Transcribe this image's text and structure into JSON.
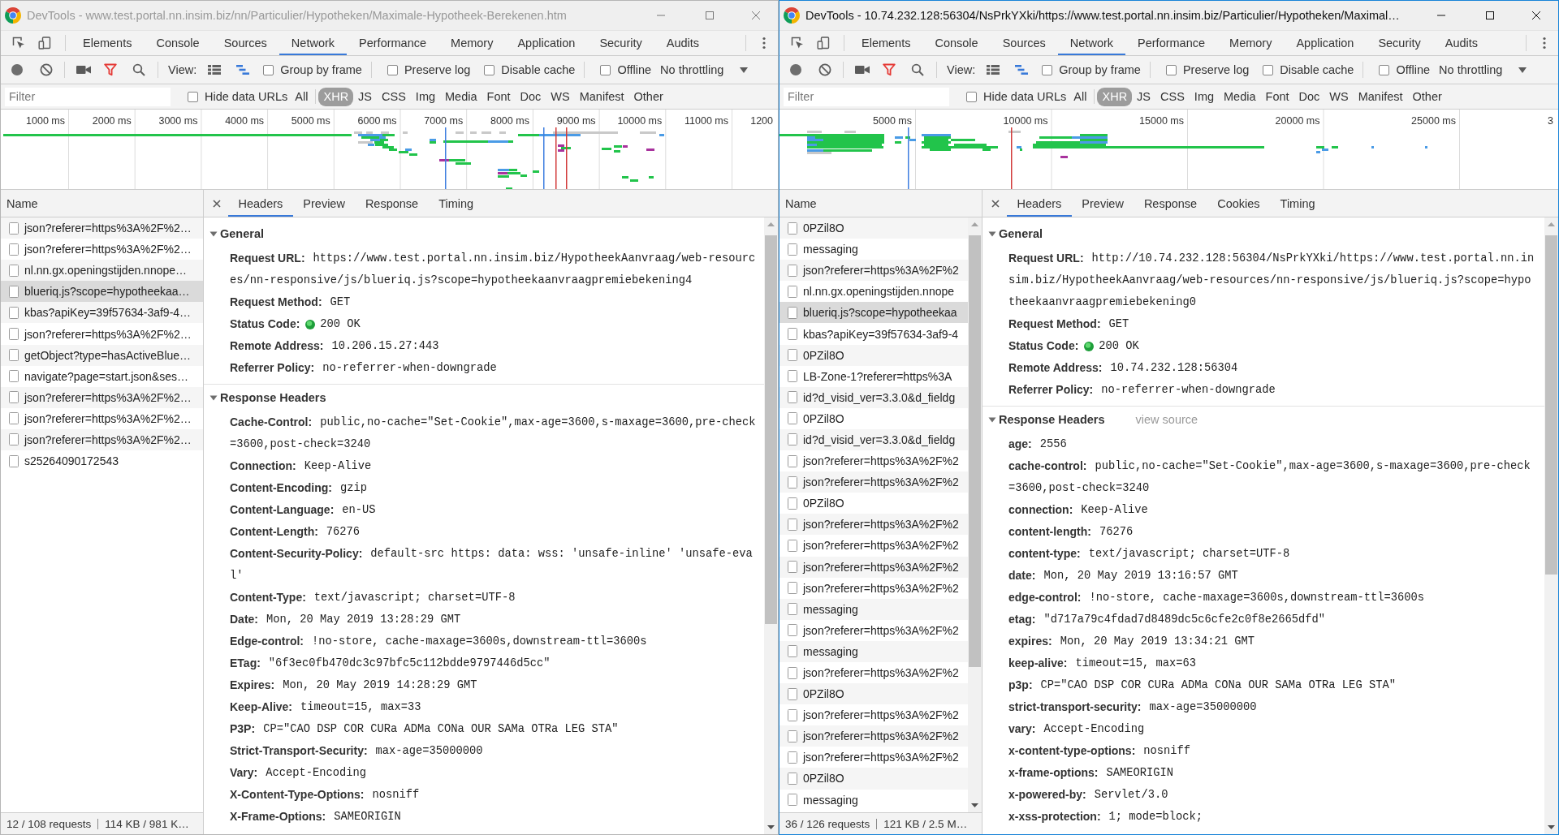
{
  "windows": [
    {
      "title": "DevTools - www.test.portal.nn.insim.biz/nn/Particulier/Hypotheken/Maximale-Hypotheek-Berekenen.htm",
      "active": false,
      "tabs": [
        {
          "label": "Elements",
          "selected": false
        },
        {
          "label": "Console",
          "selected": false
        },
        {
          "label": "Sources",
          "selected": false
        },
        {
          "label": "Network",
          "selected": true
        },
        {
          "label": "Performance",
          "selected": false
        },
        {
          "label": "Memory",
          "selected": false
        },
        {
          "label": "Application",
          "selected": false
        },
        {
          "label": "Security",
          "selected": false
        },
        {
          "label": "Audits",
          "selected": false
        }
      ],
      "toolbar": {
        "recording": false,
        "filter_on": true,
        "large_rows": false,
        "overview": true,
        "view_label": "View:",
        "option_groups": [
          [
            {
              "label": "Group by frame",
              "checked": false
            }
          ],
          [
            {
              "label": "Preserve log",
              "checked": false
            },
            {
              "label": "Disable cache",
              "checked": false
            }
          ],
          [
            {
              "label": "Offline",
              "checked": false
            }
          ]
        ],
        "throttling": "No throttling"
      },
      "filter_bar": {
        "placeholder": "Filter",
        "hide_data_urls": {
          "label": "Hide data URLs",
          "checked": false
        },
        "all": {
          "label": "All",
          "selected": false
        },
        "types": [
          {
            "label": "XHR",
            "selected": true
          },
          {
            "label": "JS",
            "selected": false
          },
          {
            "label": "CSS",
            "selected": false
          },
          {
            "label": "Img",
            "selected": false
          },
          {
            "label": "Media",
            "selected": false
          },
          {
            "label": "Font",
            "selected": false
          },
          {
            "label": "Doc",
            "selected": false
          },
          {
            "label": "WS",
            "selected": false
          },
          {
            "label": "Manifest",
            "selected": false
          },
          {
            "label": "Other",
            "selected": false
          }
        ]
      },
      "overview": {
        "ticks": [
          "1000 ms",
          "2000 ms",
          "3000 ms",
          "4000 ms",
          "5000 ms",
          "6000 ms",
          "7000 ms",
          "8000 ms",
          "9000 ms",
          "10000 ms",
          "11000 ms",
          "1200"
        ]
      },
      "requests": {
        "heading": "Name",
        "rows": [
          {
            "name": "json?referer=https%3A%2F%2…",
            "selected": false
          },
          {
            "name": "json?referer=https%3A%2F%2…",
            "selected": false
          },
          {
            "name": "nl.nn.gx.openingstijden.nnope…",
            "selected": false
          },
          {
            "name": "blueriq.js?scope=hypotheekaa…",
            "selected": true
          },
          {
            "name": "kbas?apiKey=39f57634-3af9-4…",
            "selected": false
          },
          {
            "name": "json?referer=https%3A%2F%2…",
            "selected": false
          },
          {
            "name": "getObject?type=hasActiveBlue…",
            "selected": false
          },
          {
            "name": "navigate?page=start.json&ses…",
            "selected": false
          },
          {
            "name": "json?referer=https%3A%2F%2…",
            "selected": false
          },
          {
            "name": "json?referer=https%3A%2F%2…",
            "selected": false
          },
          {
            "name": "json?referer=https%3A%2F%2…",
            "selected": false
          },
          {
            "name": "s25264090172543",
            "selected": false
          }
        ]
      },
      "details": {
        "tabs": [
          {
            "label": "Headers",
            "selected": true
          },
          {
            "label": "Preview",
            "selected": false
          },
          {
            "label": "Response",
            "selected": false
          },
          {
            "label": "Timing",
            "selected": false
          }
        ],
        "sections": [
          {
            "title": "General",
            "expanded": true,
            "headers": [
              {
                "name": "Request URL:",
                "value": "https://www.test.portal.nn.insim.biz/HypotheekAanvraag/web-resources/nn-responsive/js/blueriq.js?scope=hypotheekaanvraagpremiebekening4",
                "kind": "plain"
              },
              {
                "name": "Request Method:",
                "value": "GET",
                "kind": "plain"
              },
              {
                "name": "Status Code:",
                "value": "200 OK",
                "kind": "status"
              },
              {
                "name": "Remote Address:",
                "value": "10.206.15.27:443",
                "kind": "plain"
              },
              {
                "name": "Referrer Policy:",
                "value": "no-referrer-when-downgrade",
                "kind": "plain"
              }
            ]
          },
          {
            "title": "Response Headers",
            "expanded": true,
            "headers": [
              {
                "name": "Cache-Control:",
                "value": "public,no-cache=\"Set-Cookie\",max-age=3600,s-maxage=3600,pre-check=3600,post-check=3240",
                "kind": "plain"
              },
              {
                "name": "Connection:",
                "value": "Keep-Alive",
                "kind": "plain"
              },
              {
                "name": "Content-Encoding:",
                "value": "gzip",
                "kind": "plain"
              },
              {
                "name": "Content-Language:",
                "value": "en-US",
                "kind": "plain"
              },
              {
                "name": "Content-Length:",
                "value": "76276",
                "kind": "plain"
              },
              {
                "name": "Content-Security-Policy:",
                "value": "default-src https: data: wss: 'unsafe-inline' 'unsafe-eval'",
                "kind": "plain"
              },
              {
                "name": "Content-Type:",
                "value": "text/javascript; charset=UTF-8",
                "kind": "plain"
              },
              {
                "name": "Date:",
                "value": "Mon, 20 May 2019 13:28:29 GMT",
                "kind": "plain"
              },
              {
                "name": "Edge-control:",
                "value": "!no-store, cache-maxage=3600s,downstream-ttl=3600s",
                "kind": "plain"
              },
              {
                "name": "ETag:",
                "value": "\"6f3ec0fb470dc3c97bfc5c112bdde9797446d5cc\"",
                "kind": "plain"
              },
              {
                "name": "Expires:",
                "value": "Mon, 20 May 2019 14:28:29 GMT",
                "kind": "plain"
              },
              {
                "name": "Keep-Alive:",
                "value": "timeout=15, max=33",
                "kind": "plain"
              },
              {
                "name": "P3P:",
                "value": "CP=\"CAO DSP COR CURa ADMa CONa OUR SAMa OTRa LEG STA\"",
                "kind": "plain"
              },
              {
                "name": "Strict-Transport-Security:",
                "value": "max-age=35000000",
                "kind": "plain"
              },
              {
                "name": "Vary:",
                "value": "Accept-Encoding",
                "kind": "plain"
              },
              {
                "name": "X-Content-Type-Options:",
                "value": "nosniff",
                "kind": "plain"
              },
              {
                "name": "X-Frame-Options:",
                "value": "SAMEORIGIN",
                "kind": "plain"
              }
            ]
          }
        ]
      },
      "status_bar": {
        "requests": "12 / 108 requests",
        "transferred": "114 KB / 981 K…"
      }
    },
    {
      "title": "DevTools - 10.74.232.128:56304/NsPrkYXki/https://www.test.portal.nn.insim.biz/Particulier/Hypotheken/Maximal…",
      "active": true,
      "tabs": [
        {
          "label": "Elements",
          "selected": false
        },
        {
          "label": "Console",
          "selected": false
        },
        {
          "label": "Sources",
          "selected": false
        },
        {
          "label": "Network",
          "selected": true
        },
        {
          "label": "Performance",
          "selected": false
        },
        {
          "label": "Memory",
          "selected": false
        },
        {
          "label": "Application",
          "selected": false
        },
        {
          "label": "Security",
          "selected": false
        },
        {
          "label": "Audits",
          "selected": false
        }
      ],
      "toolbar": {
        "recording": false,
        "filter_on": true,
        "large_rows": false,
        "overview": true,
        "view_label": "View:",
        "option_groups": [
          [
            {
              "label": "Group by frame",
              "checked": false
            }
          ],
          [
            {
              "label": "Preserve log",
              "checked": false
            },
            {
              "label": "Disable cache",
              "checked": false
            }
          ],
          [
            {
              "label": "Offline",
              "checked": false
            }
          ]
        ],
        "throttling": "No throttling"
      },
      "filter_bar": {
        "placeholder": "Filter",
        "hide_data_urls": {
          "label": "Hide data URLs",
          "checked": false
        },
        "all": {
          "label": "All",
          "selected": false
        },
        "types": [
          {
            "label": "XHR",
            "selected": true
          },
          {
            "label": "JS",
            "selected": false
          },
          {
            "label": "CSS",
            "selected": false
          },
          {
            "label": "Img",
            "selected": false
          },
          {
            "label": "Media",
            "selected": false
          },
          {
            "label": "Font",
            "selected": false
          },
          {
            "label": "Doc",
            "selected": false
          },
          {
            "label": "WS",
            "selected": false
          },
          {
            "label": "Manifest",
            "selected": false
          },
          {
            "label": "Other",
            "selected": false
          }
        ]
      },
      "overview": {
        "ticks": [
          "5000 ms",
          "10000 ms",
          "15000 ms",
          "20000 ms",
          "25000 ms",
          "3"
        ]
      },
      "requests": {
        "heading": "Name",
        "rows": [
          {
            "name": "0PZil8O",
            "selected": false
          },
          {
            "name": "messaging",
            "selected": false
          },
          {
            "name": "json?referer=https%3A%2F%2",
            "selected": false
          },
          {
            "name": "nl.nn.gx.openingstijden.nnope",
            "selected": false
          },
          {
            "name": "blueriq.js?scope=hypotheekaa",
            "selected": true
          },
          {
            "name": "kbas?apiKey=39f57634-3af9-4",
            "selected": false
          },
          {
            "name": "0PZil8O",
            "selected": false
          },
          {
            "name": "LB-Zone-1?referer=https%3A",
            "selected": false
          },
          {
            "name": "id?d_visid_ver=3.3.0&d_fieldg",
            "selected": false
          },
          {
            "name": "0PZil8O",
            "selected": false
          },
          {
            "name": "id?d_visid_ver=3.3.0&d_fieldg",
            "selected": false
          },
          {
            "name": "json?referer=https%3A%2F%2",
            "selected": false
          },
          {
            "name": "json?referer=https%3A%2F%2",
            "selected": false
          },
          {
            "name": "0PZil8O",
            "selected": false
          },
          {
            "name": "json?referer=https%3A%2F%2",
            "selected": false
          },
          {
            "name": "json?referer=https%3A%2F%2",
            "selected": false
          },
          {
            "name": "json?referer=https%3A%2F%2",
            "selected": false
          },
          {
            "name": "json?referer=https%3A%2F%2",
            "selected": false
          },
          {
            "name": "messaging",
            "selected": false
          },
          {
            "name": "json?referer=https%3A%2F%2",
            "selected": false
          },
          {
            "name": "messaging",
            "selected": false
          },
          {
            "name": "json?referer=https%3A%2F%2",
            "selected": false
          },
          {
            "name": "0PZil8O",
            "selected": false
          },
          {
            "name": "json?referer=https%3A%2F%2",
            "selected": false
          },
          {
            "name": "json?referer=https%3A%2F%2",
            "selected": false
          },
          {
            "name": "json?referer=https%3A%2F%2",
            "selected": false
          },
          {
            "name": "0PZil8O",
            "selected": false
          },
          {
            "name": "messaging",
            "selected": false
          }
        ]
      },
      "details": {
        "tabs": [
          {
            "label": "Headers",
            "selected": true
          },
          {
            "label": "Preview",
            "selected": false
          },
          {
            "label": "Response",
            "selected": false
          },
          {
            "label": "Cookies",
            "selected": false
          },
          {
            "label": "Timing",
            "selected": false
          }
        ],
        "sections": [
          {
            "title": "General",
            "expanded": true,
            "headers": [
              {
                "name": "Request URL:",
                "value": "http://10.74.232.128:56304/NsPrkYXki/https://www.test.portal.nn.insim.biz/HypotheekAanvraag/web-resources/nn-responsive/js/blueriq.js?scope=hypotheekaanvraagpremiebekening0",
                "kind": "plain"
              },
              {
                "name": "Request Method:",
                "value": "GET",
                "kind": "plain"
              },
              {
                "name": "Status Code:",
                "value": "200 OK",
                "kind": "status"
              },
              {
                "name": "Remote Address:",
                "value": "10.74.232.128:56304",
                "kind": "plain"
              },
              {
                "name": "Referrer Policy:",
                "value": "no-referrer-when-downgrade",
                "kind": "plain"
              }
            ]
          },
          {
            "title": "Response Headers",
            "expanded": true,
            "link": "view source",
            "headers": [
              {
                "name": "age:",
                "value": "2556",
                "kind": "plain"
              },
              {
                "name": "cache-control:",
                "value": "public,no-cache=\"Set-Cookie\",max-age=3600,s-maxage=3600,pre-check=3600,post-check=3240",
                "kind": "plain"
              },
              {
                "name": "connection:",
                "value": "Keep-Alive",
                "kind": "plain"
              },
              {
                "name": "content-length:",
                "value": "76276",
                "kind": "plain"
              },
              {
                "name": "content-type:",
                "value": "text/javascript; charset=UTF-8",
                "kind": "plain"
              },
              {
                "name": "date:",
                "value": "Mon, 20 May 2019 13:16:57 GMT",
                "kind": "plain"
              },
              {
                "name": "edge-control:",
                "value": "!no-store, cache-maxage=3600s,downstream-ttl=3600s",
                "kind": "plain"
              },
              {
                "name": "etag:",
                "value": "\"d717a79c4fdad7d8489dc5c6cfe2c0f8e2665dfd\"",
                "kind": "plain"
              },
              {
                "name": "expires:",
                "value": "Mon, 20 May 2019 13:34:21 GMT",
                "kind": "plain"
              },
              {
                "name": "keep-alive:",
                "value": "timeout=15, max=63",
                "kind": "plain"
              },
              {
                "name": "p3p:",
                "value": "CP=\"CAO DSP COR CURa ADMa CONa OUR SAMa OTRa LEG STA\"",
                "kind": "plain"
              },
              {
                "name": "strict-transport-security:",
                "value": "max-age=35000000",
                "kind": "plain"
              },
              {
                "name": "vary:",
                "value": "Accept-Encoding",
                "kind": "plain"
              },
              {
                "name": "x-content-type-options:",
                "value": "nosniff",
                "kind": "plain"
              },
              {
                "name": "x-frame-options:",
                "value": "SAMEORIGIN",
                "kind": "plain"
              },
              {
                "name": "x-powered-by:",
                "value": "Servlet/3.0",
                "kind": "plain"
              },
              {
                "name": "x-xss-protection:",
                "value": "1; mode=block;",
                "kind": "plain"
              }
            ]
          }
        ]
      },
      "status_bar": {
        "requests": "36 / 126 requests",
        "transferred": "121 KB / 2.5 M…"
      }
    }
  ]
}
